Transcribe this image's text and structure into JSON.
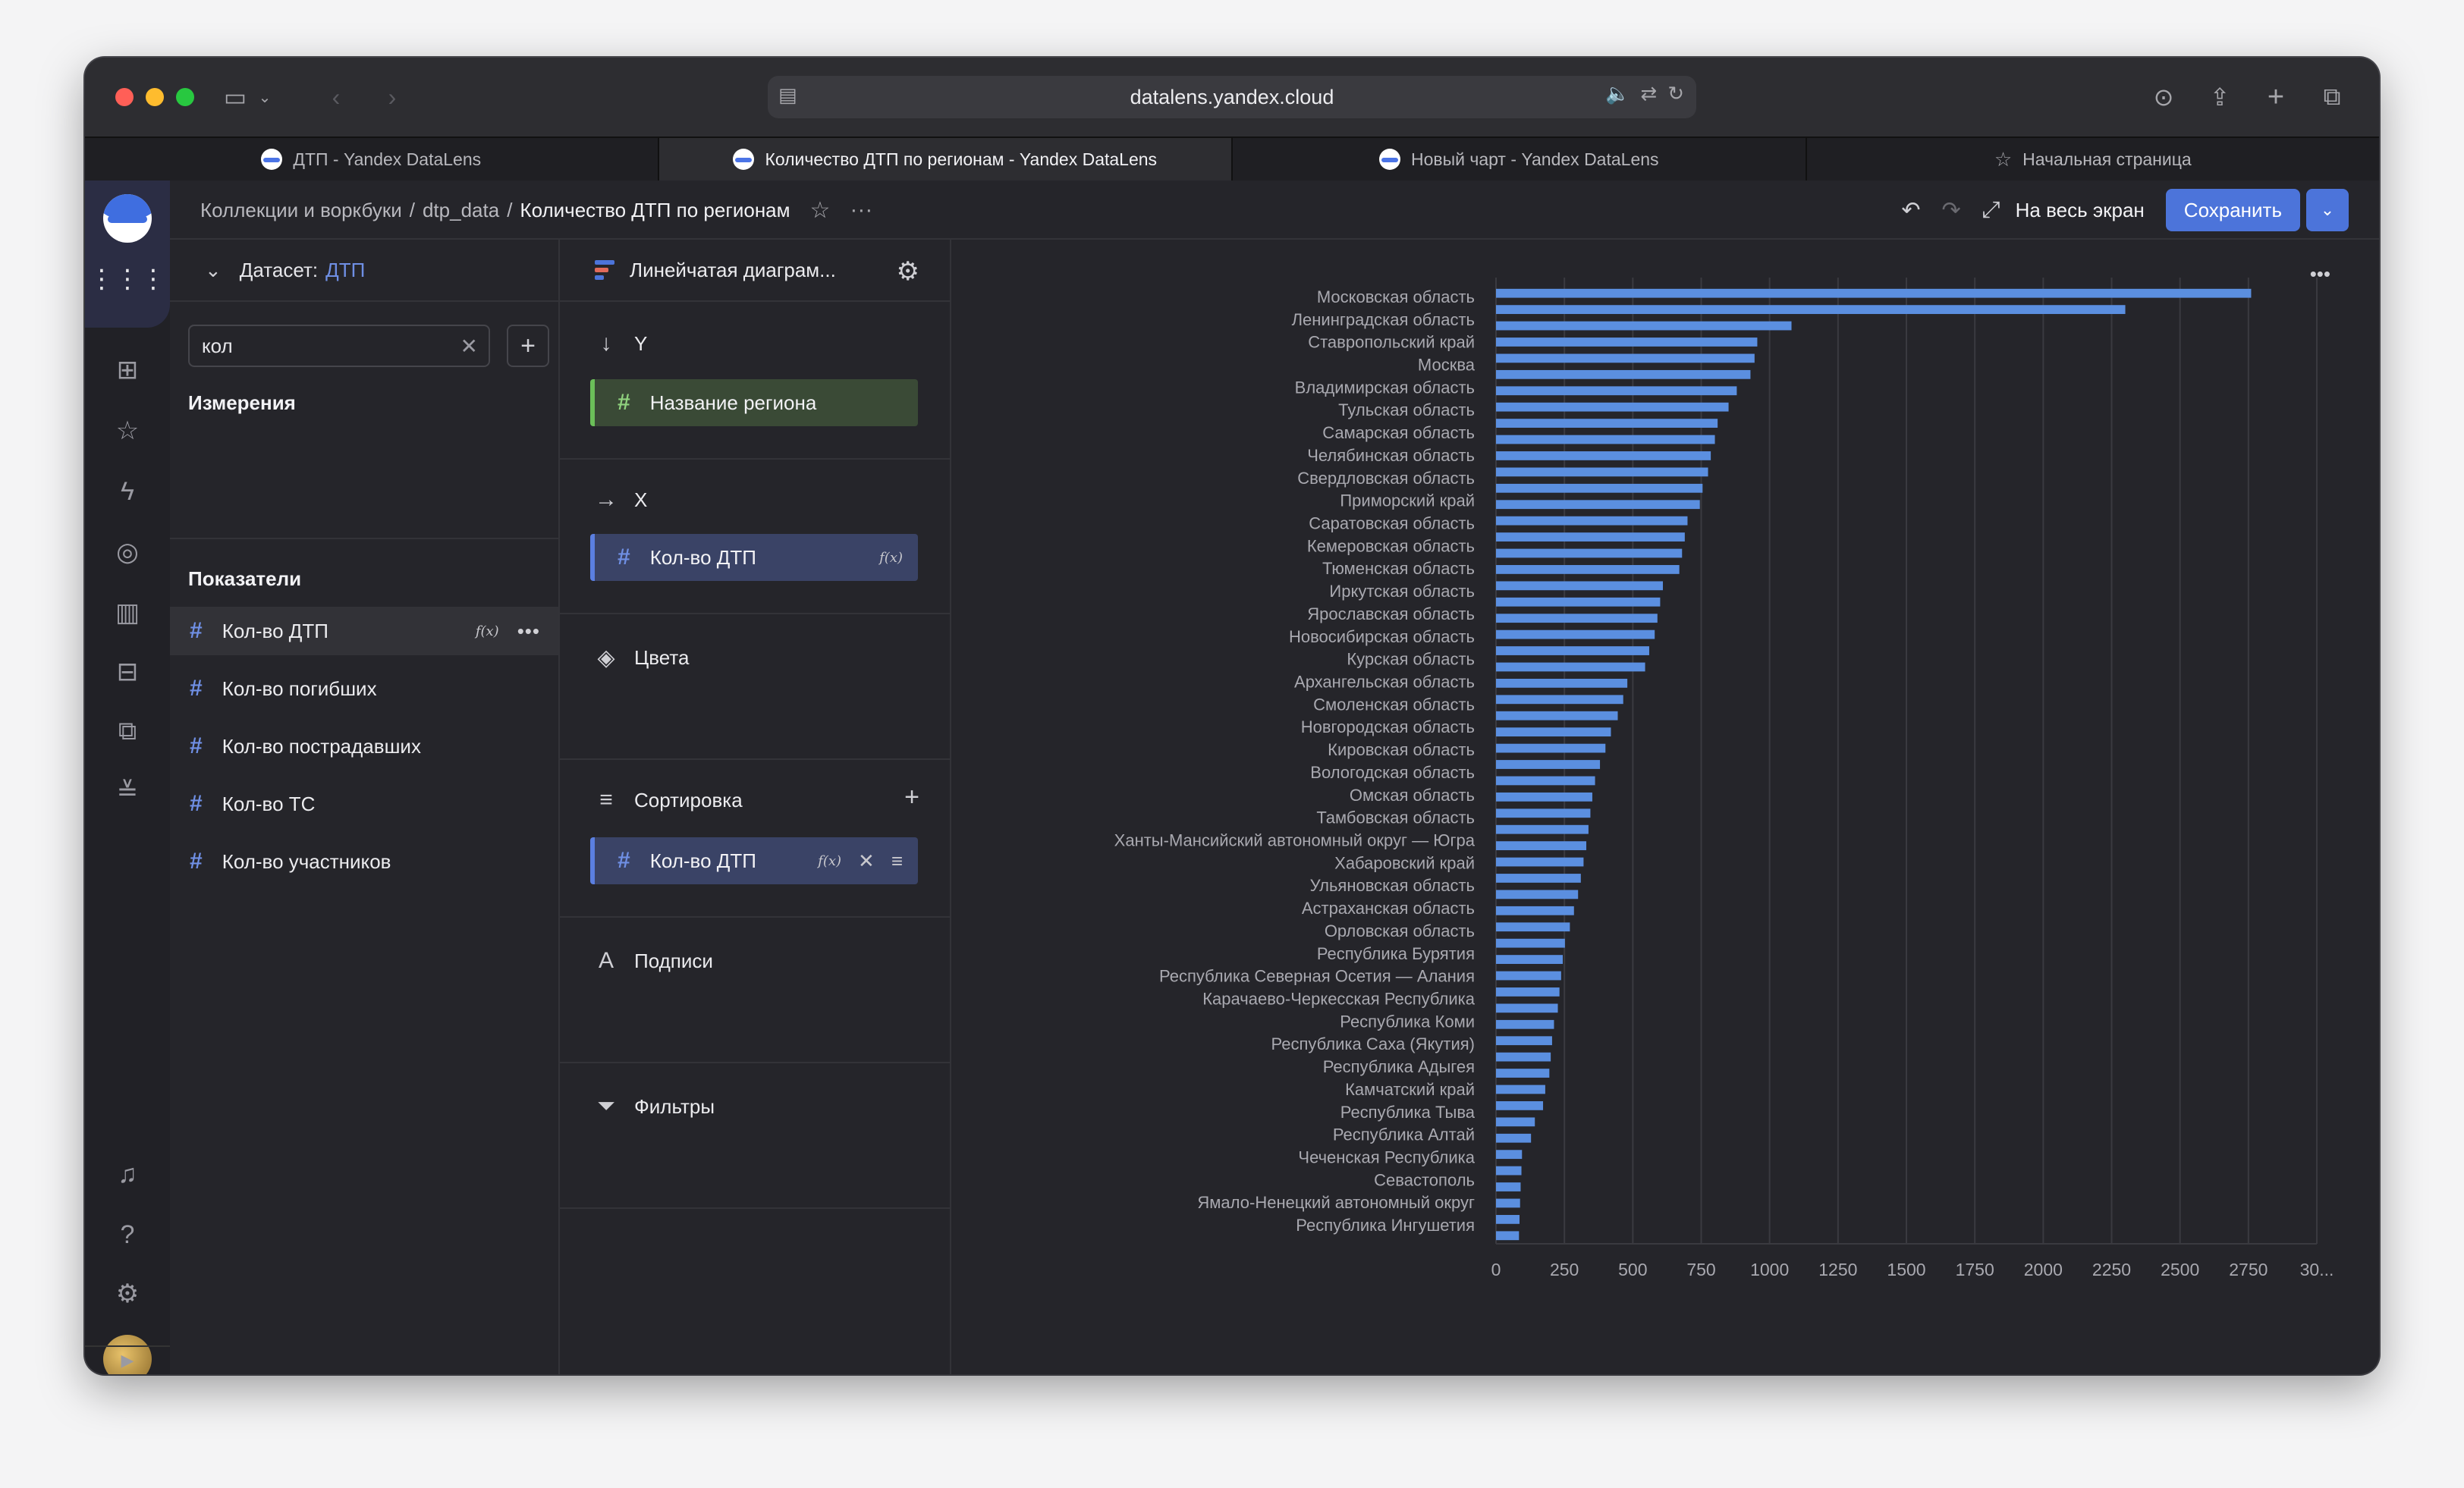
{
  "browser": {
    "url": "datalens.yandex.cloud",
    "tabs": [
      {
        "label": "ДТП - Yandex DataLens",
        "active": false,
        "icon": "datalens-logo"
      },
      {
        "label": "Количество ДТП по регионам - Yandex DataLens",
        "active": true,
        "icon": "datalens-logo"
      },
      {
        "label": "Новый чарт - Yandex DataLens",
        "active": false,
        "icon": "datalens-logo"
      },
      {
        "label": "Начальная страница",
        "active": false,
        "icon": "star-icon"
      }
    ]
  },
  "header": {
    "breadcrumbs": [
      "Коллекции и воркбуки",
      "dtp_data"
    ],
    "separator": "/",
    "title": "Количество ДТП по регионам",
    "fullscreen_label": "На весь экран",
    "save_label": "Сохранить"
  },
  "dataset_panel": {
    "dataset_label": "Датасет:",
    "dataset_name": "ДТП",
    "search_value": "кол",
    "dimensions_title": "Измерения",
    "measures_title": "Показатели",
    "measures": [
      {
        "label": "Кол-во ДТП",
        "formula": "f(x)",
        "active": true
      },
      {
        "label": "Кол-во погибших"
      },
      {
        "label": "Кол-во пострадавших"
      },
      {
        "label": "Кол-во ТС"
      },
      {
        "label": "Кол-во участников"
      }
    ]
  },
  "wizard": {
    "visualization": "Линейчатая диаграм...",
    "sections": {
      "y_title": "Y",
      "y_field": "Название региона",
      "x_title": "X",
      "x_field": "Кол-во ДТП",
      "x_field_formula": "f(x)",
      "colors_title": "Цвета",
      "sort_title": "Сортировка",
      "sort_field": "Кол-во ДТП",
      "sort_field_formula": "f(x)",
      "labels_title": "Подписи",
      "filters_title": "Фильтры"
    }
  },
  "colors": {
    "accent": "#4c74da",
    "bar": "#5b8fe0",
    "grid": "#3a3a40",
    "label": "#a9a9b0"
  },
  "chart_data": {
    "type": "bar",
    "orientation": "horizontal",
    "categories": [
      "Московская область",
      "Ленинградская область",
      "Ставропольский край",
      "Москва",
      "Владимирская область",
      "Тульская область",
      "Самарская область",
      "Челябинская область",
      "Свердловская область",
      "Приморский край",
      "Саратовская область",
      "Кемеровская область",
      "Тюменская область",
      "Иркутская область",
      "Ярославская область",
      "Новосибирская область",
      "Курская область",
      "Архангельская область",
      "Смоленская область",
      "Новгородская область",
      "Кировская область",
      "Вологодская область",
      "Омская область",
      "Тамбовская область",
      "Ханты-Мансийский автономный округ — Югра",
      "Хабаровский край",
      "Ульяновская область",
      "Астраханская область",
      "Орловская область",
      "Республика Бурятия",
      "Республика Северная Осетия — Алания",
      "Карачаево-Черкесская Республика",
      "Республика Коми",
      "Республика Саха (Якутия)",
      "Республика Адыгея",
      "Камчатский край",
      "Республика Тыва",
      "Республика Алтай",
      "Чеченская Республика",
      "Севастополь",
      "Ямало-Ненецкий автономный округ",
      "Республика Ингушетия"
    ],
    "visible_labels": [
      "Московская область",
      "Ленинградская область",
      "Ставропольский край",
      "Москва",
      "Владимирская область",
      "Тульская область",
      "Самарская область",
      "Челябинская область",
      "Свердловская область",
      "Приморский край",
      "Саратовская область",
      "Кемеровская область",
      "Тюменская область",
      "Иркутская область",
      "Ярославская область",
      "Новосибирская область",
      "Курская область",
      "Архангельская область",
      "Смоленская область",
      "Новгородская область",
      "Кировская область",
      "Вологодская область",
      "Омская область",
      "Тамбовская область",
      "Ханты-Мансийский автономный округ — Югра",
      "Хабаровский край",
      "Ульяновская область",
      "Астраханская область",
      "Орловская область",
      "Республика Бурятия",
      "Республика Северная Осетия — Алания",
      "Карачаево-Черкесская Республика",
      "Республика Коми",
      "Республика Саха (Якутия)",
      "Республика Адыгея",
      "Камчатский край",
      "Республика Тыва",
      "Республика Алтай",
      "Чеченская Республика",
      "Севастополь",
      "Ямало-Ненецкий автономный округ",
      "Республика Ингушетия"
    ],
    "values": [
      2760,
      2300,
      1080,
      955,
      945,
      930,
      880,
      850,
      810,
      800,
      785,
      775,
      755,
      745,
      700,
      690,
      680,
      670,
      610,
      600,
      590,
      580,
      560,
      545,
      480,
      465,
      445,
      420,
      400,
      380,
      362,
      352,
      345,
      338,
      330,
      320,
      310,
      300,
      285,
      270,
      252,
      244,
      238,
      232,
      226,
      212,
      205,
      200,
      195,
      180,
      172,
      142,
      128,
      95,
      93,
      90,
      88,
      86,
      84
    ],
    "xlim": [
      0,
      3000
    ],
    "x_ticks": [
      "0",
      "250",
      "500",
      "750",
      "1000",
      "1250",
      "1500",
      "1750",
      "2000",
      "2250",
      "2500",
      "2750",
      "30..."
    ],
    "grid": true,
    "xlabel": "",
    "ylabel": ""
  }
}
